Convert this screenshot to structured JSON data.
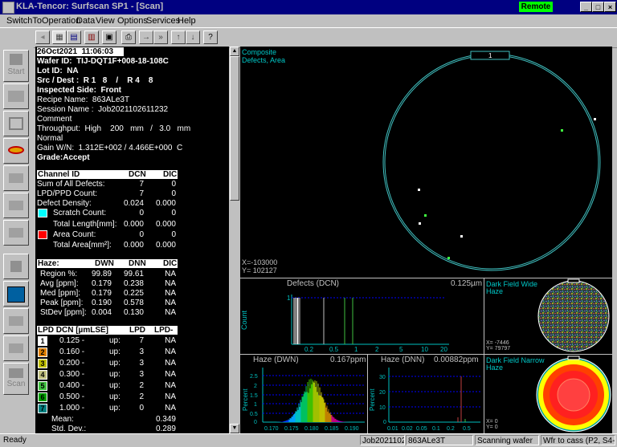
{
  "window": {
    "title": "KLA-Tencor: Surfscan SP1 - [Scan]",
    "remote_badge": "Remote",
    "doc_controls": [
      "_",
      "□",
      "×"
    ]
  },
  "menu": [
    "SwitchTo",
    "Operation",
    "Data",
    "View",
    "Options",
    "Services",
    "Help"
  ],
  "nav": {
    "start_label": "Start",
    "scan_label": "Scan"
  },
  "info": {
    "datetime": "26Oct2021  11:06:03",
    "wafer_id": "Wafer ID:  TIJ-DQT1F+008-18-108C",
    "lot_id": "Lot ID:  NA",
    "src_dest": "Src / Dest :  R 1   8    /    R 4    8",
    "inspected_side": "Inspected Side:  Front",
    "recipe": "Recipe Name:  863ALe3T",
    "session": "Session Name :  Job2021102611232",
    "comment": "Comment",
    "throughput": "Throughput:  High    200   mm   /   3.0   mm",
    "normal": "Normal",
    "gain": "Gain W/N:  1.312E+002 / 4.466E+000  C",
    "grade": "Grade:Accept"
  },
  "channel": {
    "headers": [
      "Channel ID",
      "DCN",
      "DIC"
    ],
    "rows": [
      {
        "label": "Sum of All Defects:",
        "dcn": "7",
        "dic": "0"
      },
      {
        "label": "LPD/PPD Count:",
        "dcn": "7",
        "dic": "0"
      },
      {
        "label": "Defect Density:",
        "dcn": "0.024",
        "dic": "0.000"
      },
      {
        "label": "Scratch Count:",
        "dcn": "0",
        "dic": "0"
      },
      {
        "label": "Total Length[mm]:",
        "dcn": "0.000",
        "dic": "0.000"
      },
      {
        "label": "Area Count:",
        "dcn": "0",
        "dic": "0"
      },
      {
        "label": "Total Area[mm²]:",
        "dcn": "0.000",
        "dic": "0.000"
      }
    ]
  },
  "haze": {
    "headers": [
      "Haze:",
      "DWN",
      "DNN",
      "DIC"
    ],
    "rows": [
      {
        "label": "Region %:",
        "dwn": "99.89",
        "dnn": "99.61",
        "dic": "NA"
      },
      {
        "label": "Avg [ppm]:",
        "dwn": "0.179",
        "dnn": "0.238",
        "dic": "NA"
      },
      {
        "label": "Med [ppm]:",
        "dwn": "0.179",
        "dnn": "0.225",
        "dic": "NA"
      },
      {
        "label": "Peak [ppm]:",
        "dwn": "0.190",
        "dnn": "0.578",
        "dic": "NA"
      },
      {
        "label": "StDev [ppm]:",
        "dwn": "0.004",
        "dnn": "0.130",
        "dic": "NA"
      }
    ]
  },
  "lpd": {
    "headers": [
      "LPD DCN  [µmLSE]",
      "LPD",
      "LPD-N"
    ],
    "rows": [
      {
        "n": "1",
        "size": "0.125 -",
        "dir": "up:",
        "count": "7",
        "na": "NA",
        "color": "#ffffff"
      },
      {
        "n": "2",
        "size": "0.160 -",
        "dir": "up:",
        "count": "3",
        "na": "NA",
        "color": "#e08000"
      },
      {
        "n": "3",
        "size": "0.200 -",
        "dir": "up:",
        "count": "3",
        "na": "NA",
        "color": "#c0c000"
      },
      {
        "n": "4",
        "size": "0.300 -",
        "dir": "up:",
        "count": "3",
        "na": "NA",
        "color": "#c0c080"
      },
      {
        "n": "5",
        "size": "0.400 -",
        "dir": "up:",
        "count": "2",
        "na": "NA",
        "color": "#40c040"
      },
      {
        "n": "6",
        "size": "0.500 -",
        "dir": "up:",
        "count": "2",
        "na": "NA",
        "color": "#00a000"
      },
      {
        "n": "7",
        "size": "1.000 -",
        "dir": "up:",
        "count": "0",
        "na": "NA",
        "color": "#008080"
      }
    ],
    "mean_label": "Mean:",
    "mean_value": "0.349",
    "stdev_label": "Std. Dev.:",
    "stdev_value": "0.289"
  },
  "map": {
    "label_line1": "Composite",
    "label_line2": "Defects, Area",
    "notch_label": "1",
    "coord_x": "X=-103000",
    "coord_y": "Y=  102127"
  },
  "charts": {
    "defects": {
      "title": "Defects (DCN)",
      "unit": "0.125µm",
      "ylabel": "Count",
      "y_tick": "1",
      "x_ticks": [
        "0.2",
        "0.5",
        "1",
        "2",
        "5",
        "10",
        "20"
      ]
    },
    "haze_dwn": {
      "title": "Haze (DWN)",
      "unit": "0.167ppm",
      "ylabel": "Percent",
      "y_ticks": [
        "2.5",
        "2",
        "1.5",
        "1",
        "0.5",
        "0"
      ],
      "x_ticks": [
        "0.170",
        "0.175",
        "0.180",
        "0.185",
        "0.190"
      ]
    },
    "haze_dnn": {
      "title": "Haze (DNN)",
      "unit": "0.00882ppm",
      "ylabel": "Percent",
      "y_ticks": [
        "30",
        "20",
        "10",
        "0"
      ],
      "x_ticks": [
        "0.01",
        "0.02",
        "0.05",
        "0.1",
        "0.2",
        "0.5"
      ]
    },
    "dfw": {
      "title1": "Dark Field Wide",
      "title2": "Haze",
      "x": "X=   -7446",
      "y": "Y=   79797"
    },
    "dfn": {
      "title1": "Dark Field Narrow",
      "title2": "Haze",
      "x": "X=      0",
      "y": "Y=      0"
    }
  },
  "status": {
    "ready": "Ready",
    "job": "Job20211026",
    "recipe": "863ALe3T",
    "state": "Scanning wafer",
    "cassette": "Wfr to cass (P2, S4-8)"
  }
}
